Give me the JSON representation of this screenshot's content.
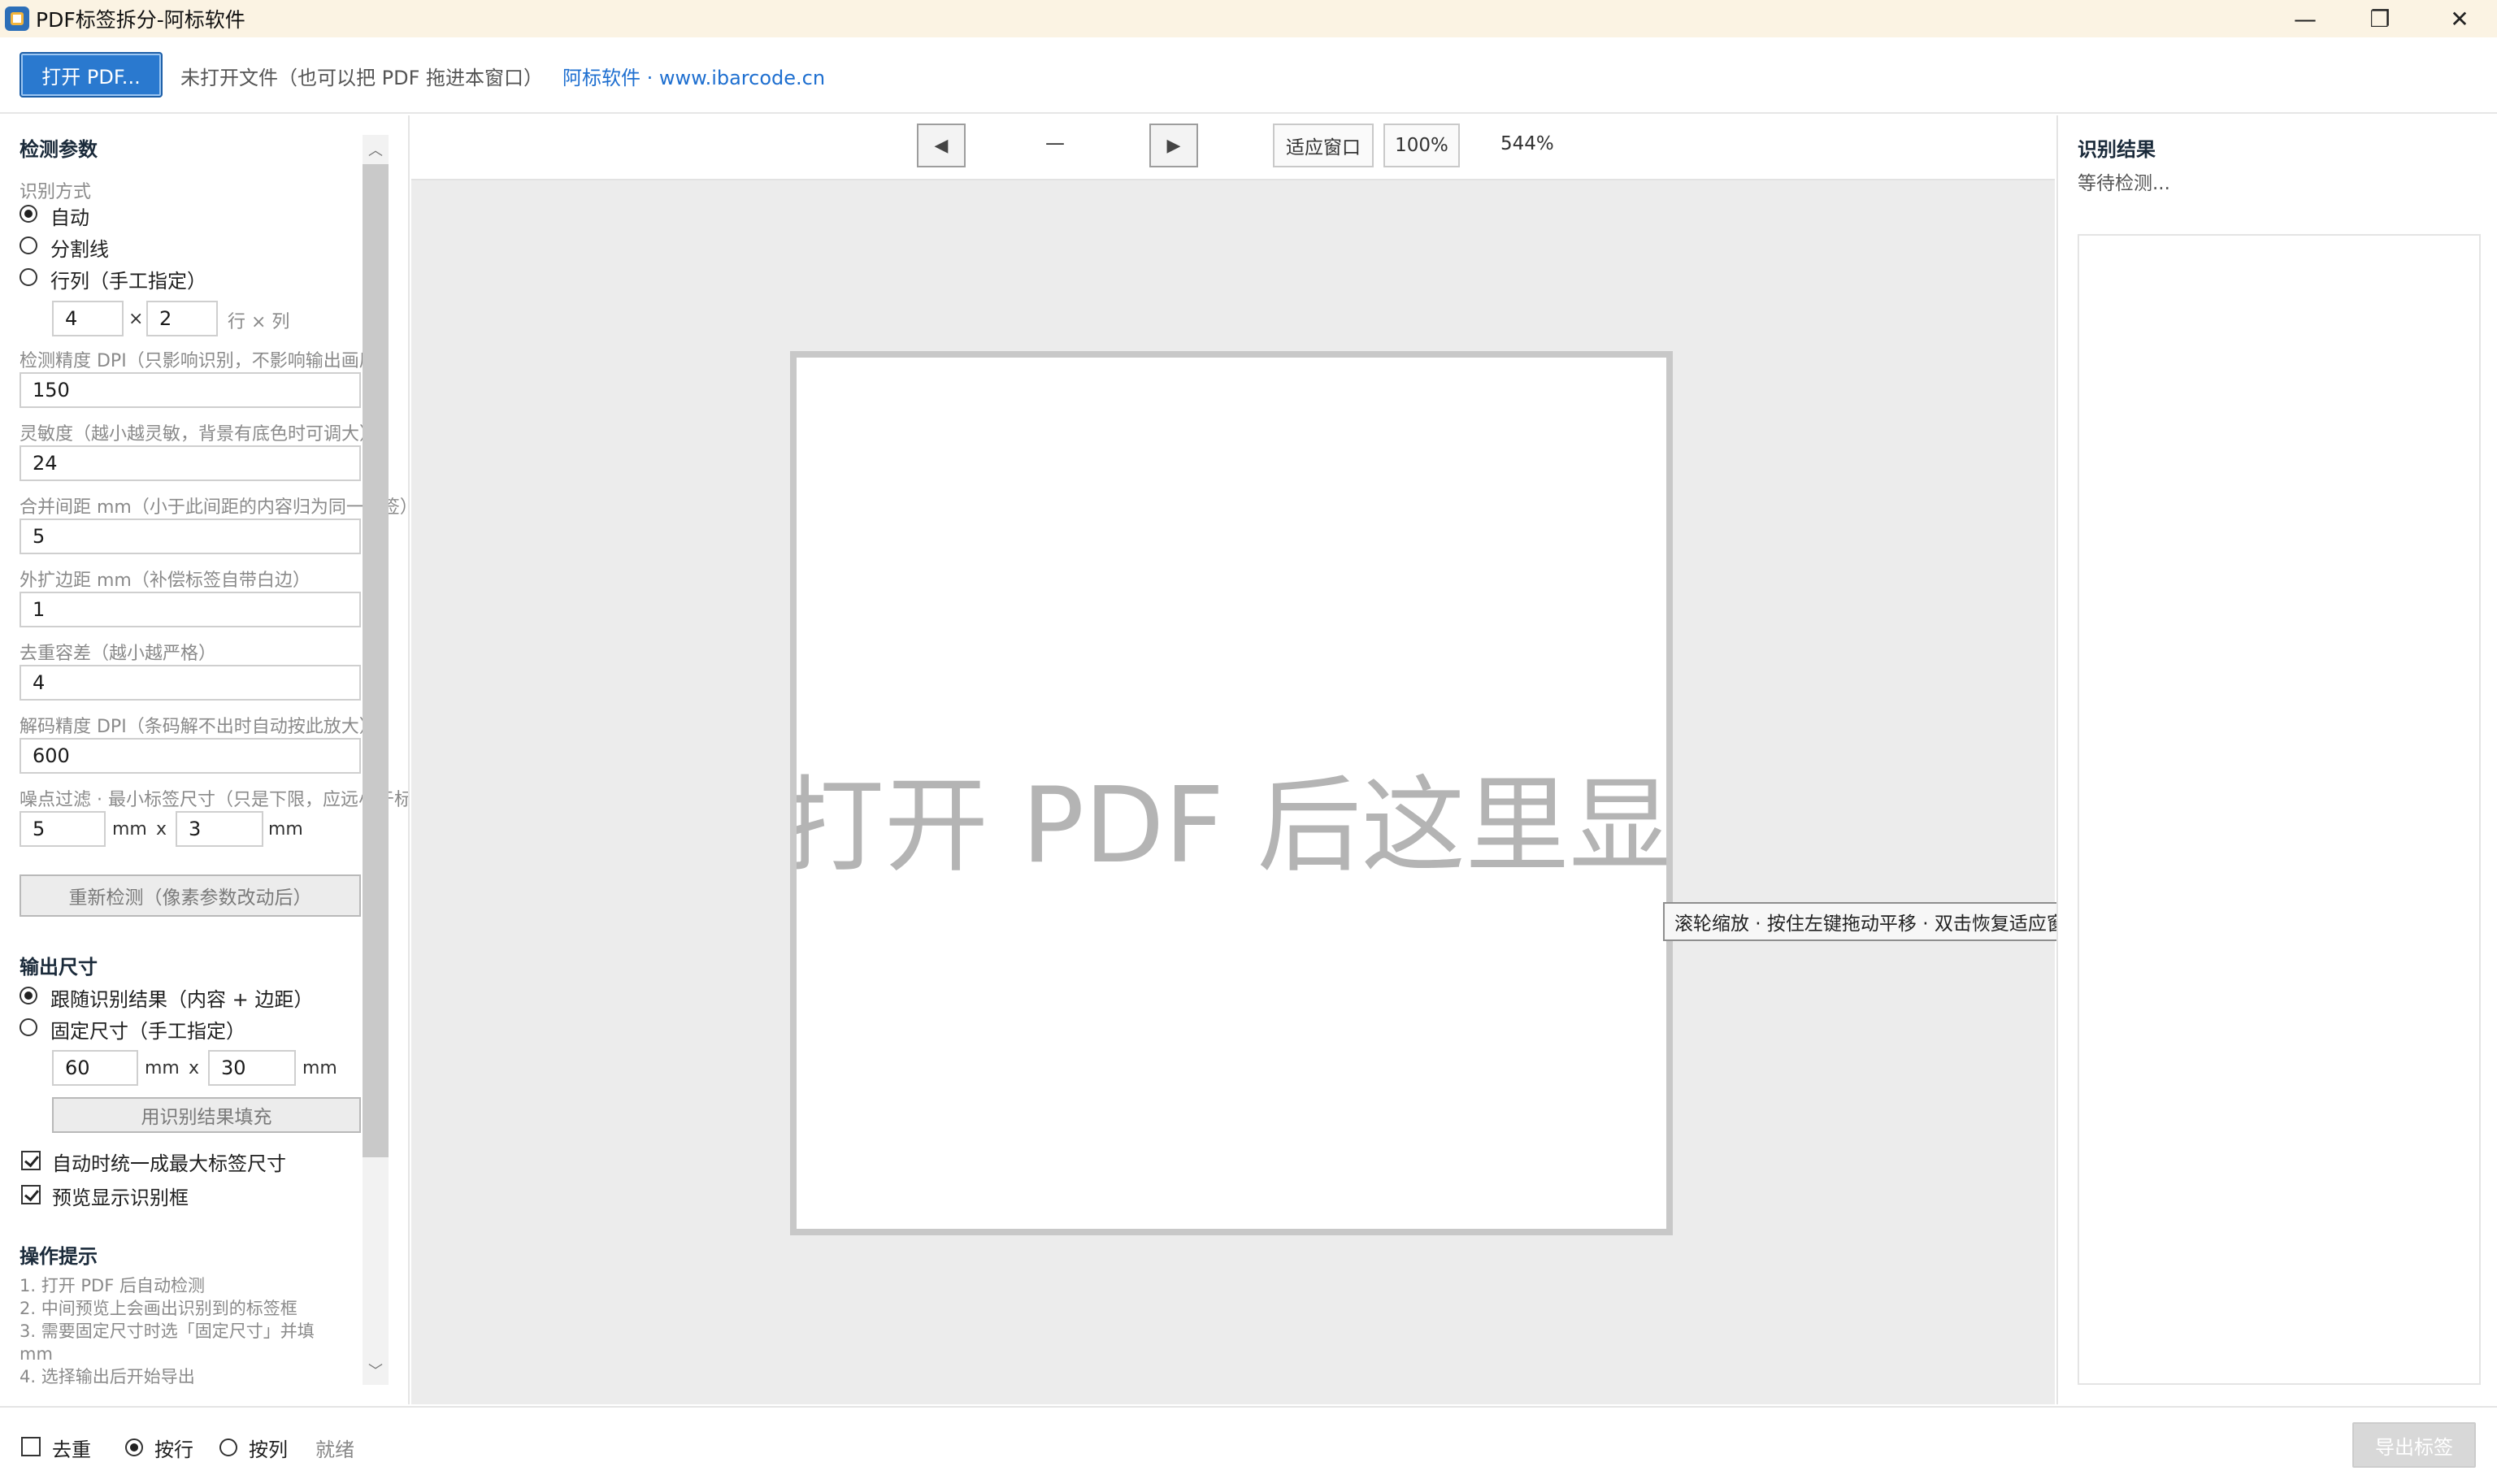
{
  "window": {
    "title": "PDF标签拆分-阿标软件",
    "min_glyph": "—",
    "max_glyph": "❐",
    "close_glyph": "✕"
  },
  "toolbar": {
    "open_button": "打开 PDF...",
    "file_status": "未打开文件（也可以把 PDF 拖进本窗口）",
    "site_link": "阿标软件 · www.ibarcode.cn"
  },
  "detect": {
    "section_title": "检测参数",
    "mode_label": "识别方式",
    "modes": [
      {
        "label": "自动",
        "selected": true
      },
      {
        "label": "分割线",
        "selected": false
      },
      {
        "label": "行列（手工指定）",
        "selected": false
      }
    ],
    "rows": "4",
    "times": "×",
    "cols": "2",
    "rows_cols_suffix": "行 × 列",
    "dpi_label": "检测精度 DPI（只影响识别，不影响输出画质）",
    "dpi_value": "150",
    "sensitivity_label": "灵敏度（越小越灵敏，背景有底色时可调大）",
    "sensitivity_value": "24",
    "merge_label": "合并间距 mm（小于此间距的内容归为同一标签）",
    "merge_value": "5",
    "expand_label": "外扩边距 mm（补偿标签自带白边）",
    "expand_value": "1",
    "dedup_label": "去重容差（越小越严格）",
    "dedup_value": "4",
    "decode_label": "解码精度 DPI（条码解不出时自动按此放大）",
    "decode_value": "600",
    "noise_label": "噪点过滤 · 最小标签尺寸（只是下限，应远小于标签）",
    "noise_w": "5",
    "noise_h": "3",
    "unit_mm": "mm",
    "x_sep": "x",
    "redetect_button": "重新检测（像素参数改动后）"
  },
  "output": {
    "section_title": "输出尺寸",
    "modes": [
      {
        "label": "跟随识别结果（内容 + 边距）",
        "selected": true
      },
      {
        "label": "固定尺寸（手工指定）",
        "selected": false
      }
    ],
    "width": "60",
    "height": "30",
    "fill_button": "用识别结果填充",
    "unify_checkbox": "自动时统一成最大标签尺寸",
    "unify_checked": true,
    "preview_checkbox": "预览显示识别框",
    "preview_checked": true
  },
  "hints": {
    "section_title": "操作提示",
    "lines": [
      "1. 打开 PDF 后自动检测",
      "2. 中间预览上会画出识别到的标签框",
      "3. 需要固定尺寸时选「固定尺寸」并填",
      "mm",
      "4. 选择输出后开始导出"
    ]
  },
  "preview": {
    "prev_button": "◀",
    "next_button": "▶",
    "page_indicator": "—",
    "fit_button": "适应窗口",
    "zoom_100_button": "100%",
    "zoom_value": "544%",
    "placeholder": "打开 PDF 后这里显示预览",
    "tooltip": "滚轮缩放 · 按住左键拖动平移 · 双击恢复适应窗口"
  },
  "results": {
    "title": "识别结果",
    "status": "等待检测..."
  },
  "statusbar": {
    "dedup_checkbox": "去重",
    "dedup_checked": false,
    "order_options": [
      {
        "label": "按行",
        "selected": true
      },
      {
        "label": "按列",
        "selected": false
      }
    ],
    "status": "就绪",
    "export_button": "导出标签"
  },
  "colors": {
    "accent": "#2a79cf",
    "link": "#1e6fd0",
    "titlebar_bg": "#fbf3e3",
    "preview_bg": "#ececec"
  }
}
